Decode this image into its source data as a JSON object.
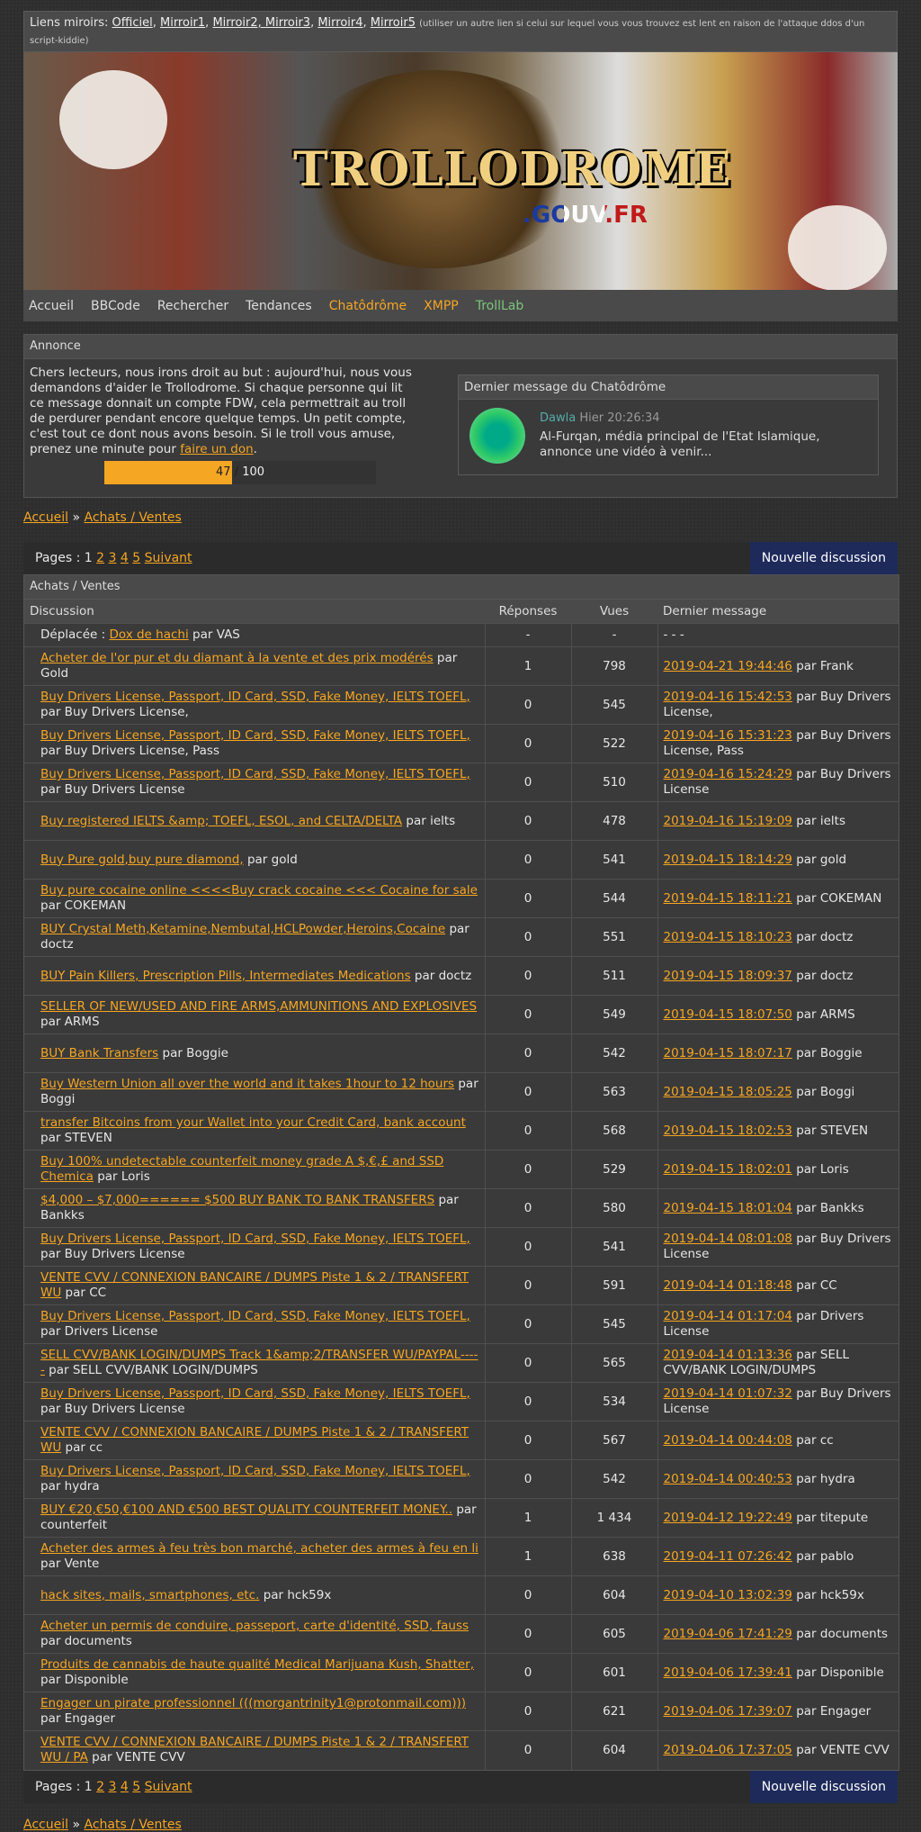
{
  "mirrors": {
    "prefix": "Liens miroirs:",
    "links": [
      "Officiel",
      "Mirroir1",
      "Mirroir2, Mirroir3",
      "Mirroir4",
      "Mirroir5"
    ],
    "note": "(utiliser un autre lien si celui sur lequel vous vous trouvez est lent en raison de l'attaque ddos d'un script-kiddie)"
  },
  "banner": {
    "logo": "TROLLODROME",
    "sub": ".GOUV.FR"
  },
  "nav": [
    "Accueil",
    "BBCode",
    "Rechercher",
    "Tendances",
    "Chatôdrôme",
    "XMPP",
    "TrollLab"
  ],
  "annonce": {
    "title": "Annonce",
    "text": "Chers lecteurs, nous irons droit au but : aujourd'hui, nous vous demandons d'aider le Trollodrome. Si chaque personne qui lit ce message donnait un compte FDW, cela permettrait au troll de perdurer pendant encore quelque temps. Un petit compte, c'est tout ce dont nous avons besoin. Si le troll vous amuse, prenez une minute pour",
    "link": "faire un don",
    "end": ".",
    "progress": {
      "value": 47,
      "max": 100,
      "label_value": "47",
      "label_sep": " / ",
      "label_max": "100"
    }
  },
  "chat": {
    "title": "Dernier message du Chatôdrôme",
    "user": "Dawla",
    "time": "Hier 20:26:34",
    "message": "Al-Furqan, média principal de l'Etat Islamique, annonce une vidéo à venir..."
  },
  "crumb": {
    "home": "Accueil",
    "sep": "»",
    "section": "Achats / Ventes"
  },
  "pager": {
    "label": "Pages : 1",
    "pages": [
      "2",
      "3",
      "4",
      "5"
    ],
    "next": "Suivant",
    "new": "Nouvelle discussion"
  },
  "forum": {
    "title": "Achats / Ventes",
    "cols": [
      "Discussion",
      "Réponses",
      "Vues",
      "Dernier message"
    ],
    "moved": {
      "prefix": "Déplacée :",
      "title": "Dox de hachi",
      "by": "par VAS",
      "rep": "-",
      "views": "-",
      "last": "- - -"
    },
    "rows": [
      {
        "title": "Acheter de l'or pur et du diamant à la vente et des prix modérés",
        "by": "par Gold",
        "rep": "1",
        "views": "798",
        "date": "2019-04-21 19:44:46",
        "last": "par Frank"
      },
      {
        "title": "Buy Drivers License, Passport, ID Card, SSD, Fake Money, IELTS TOEFL,",
        "by": "par Buy Drivers License,",
        "rep": "0",
        "views": "545",
        "date": "2019-04-16 15:42:53",
        "last": "par Buy Drivers License,"
      },
      {
        "title": "Buy Drivers License, Passport, ID Card, SSD, Fake Money, IELTS TOEFL,",
        "by": "par Buy Drivers License, Pass",
        "rep": "0",
        "views": "522",
        "date": "2019-04-16 15:31:23",
        "last": "par Buy Drivers License, Pass"
      },
      {
        "title": "Buy Drivers License, Passport, ID Card, SSD, Fake Money, IELTS TOEFL,",
        "by": "par Buy Drivers License",
        "rep": "0",
        "views": "510",
        "date": "2019-04-16 15:24:29",
        "last": "par Buy Drivers License"
      },
      {
        "title": "Buy registered IELTS &amp; TOEFL, ESOL, and CELTA/DELTA",
        "by": "par ielts",
        "rep": "0",
        "views": "478",
        "date": "2019-04-16 15:19:09",
        "last": "par ielts"
      },
      {
        "title": "Buy Pure gold,buy pure diamond,",
        "by": "par gold",
        "rep": "0",
        "views": "541",
        "date": "2019-04-15 18:14:29",
        "last": "par gold"
      },
      {
        "title": "Buy pure cocaine online <<<<Buy crack cocaine <<< Cocaine for sale",
        "by": "par COKEMAN",
        "rep": "0",
        "views": "544",
        "date": "2019-04-15 18:11:21",
        "last": "par COKEMAN"
      },
      {
        "title": "BUY Crystal Meth,Ketamine,Nembutal,HCLPowder,Heroins,Cocaine",
        "by": "par doctz",
        "rep": "0",
        "views": "551",
        "date": "2019-04-15 18:10:23",
        "last": "par doctz"
      },
      {
        "title": "BUY Pain Killers, Prescription Pills, Intermediates Medications",
        "by": "par doctz",
        "rep": "0",
        "views": "511",
        "date": "2019-04-15 18:09:37",
        "last": "par doctz"
      },
      {
        "title": "SELLER OF NEW/USED AND FIRE ARMS,AMMUNITIONS AND EXPLOSIVES",
        "by": "par ARMS",
        "rep": "0",
        "views": "549",
        "date": "2019-04-15 18:07:50",
        "last": "par ARMS"
      },
      {
        "title": "BUY Bank Transfers",
        "by": "par Boggie",
        "rep": "0",
        "views": "542",
        "date": "2019-04-15 18:07:17",
        "last": "par Boggie"
      },
      {
        "title": "Buy Western Union all over the world and it takes 1hour to 12 hours",
        "by": "par Boggi",
        "rep": "0",
        "views": "563",
        "date": "2019-04-15 18:05:25",
        "last": "par Boggi"
      },
      {
        "title": "transfer Bitcoins from your Wallet into your Credit Card, bank account",
        "by": "par STEVEN",
        "rep": "0",
        "views": "568",
        "date": "2019-04-15 18:02:53",
        "last": "par STEVEN"
      },
      {
        "title": "Buy 100% undetectable counterfeit money grade A $,€,£ and SSD Chemica",
        "by": "par Loris",
        "rep": "0",
        "views": "529",
        "date": "2019-04-15 18:02:01",
        "last": "par Loris"
      },
      {
        "title": "$4,000 – $7,000====== $500 BUY BANK TO BANK TRANSFERS",
        "by": "par Bankks",
        "rep": "0",
        "views": "580",
        "date": "2019-04-15 18:01:04",
        "last": "par Bankks"
      },
      {
        "title": "Buy Drivers License, Passport, ID Card, SSD, Fake Money, IELTS TOEFL,",
        "by": "par Buy Drivers License",
        "rep": "0",
        "views": "541",
        "date": "2019-04-14 08:01:08",
        "last": "par Buy Drivers License"
      },
      {
        "title": "VENTE CVV / CONNEXION BANCAIRE / DUMPS Piste 1 & 2 / TRANSFERT WU",
        "by": "par CC",
        "rep": "0",
        "views": "591",
        "date": "2019-04-14 01:18:48",
        "last": "par CC"
      },
      {
        "title": "Buy Drivers License, Passport, ID Card, SSD, Fake Money, IELTS TOEFL,",
        "by": "par Drivers License",
        "rep": "0",
        "views": "545",
        "date": "2019-04-14 01:17:04",
        "last": "par Drivers License"
      },
      {
        "title": "SELL CVV/BANK LOGIN/DUMPS Track 1&amp;2/TRANSFER WU/PAYPAL-----",
        "by": "par SELL CVV/BANK LOGIN/DUMPS",
        "rep": "0",
        "views": "565",
        "date": "2019-04-14 01:13:36",
        "last": "par SELL CVV/BANK LOGIN/DUMPS"
      },
      {
        "title": "Buy Drivers License, Passport, ID Card, SSD, Fake Money, IELTS TOEFL,",
        "by": "par Buy Drivers License",
        "rep": "0",
        "views": "534",
        "date": "2019-04-14 01:07:32",
        "last": "par Buy Drivers License"
      },
      {
        "title": "VENTE CVV / CONNEXION BANCAIRE / DUMPS Piste 1 & 2 / TRANSFERT WU",
        "by": "par cc",
        "rep": "0",
        "views": "567",
        "date": "2019-04-14 00:44:08",
        "last": "par cc"
      },
      {
        "title": "Buy Drivers License, Passport, ID Card, SSD, Fake Money, IELTS TOEFL,",
        "by": "par hydra",
        "rep": "0",
        "views": "542",
        "date": "2019-04-14 00:40:53",
        "last": "par hydra"
      },
      {
        "title": "BUY €20,€50,€100 AND €500 BEST QUALITY COUNTERFEIT MONEY..",
        "by": "par counterfeit",
        "rep": "1",
        "views": "1 434",
        "date": "2019-04-12 19:22:49",
        "last": "par titepute"
      },
      {
        "title": "Acheter des armes à feu très bon marché, acheter des armes à feu en li",
        "by": "par Vente",
        "rep": "1",
        "views": "638",
        "date": "2019-04-11 07:26:42",
        "last": "par pablo"
      },
      {
        "title": "hack sites, mails, smartphones, etc.",
        "by": "par hck59x",
        "rep": "0",
        "views": "604",
        "date": "2019-04-10 13:02:39",
        "last": "par hck59x"
      },
      {
        "title": "Acheter un permis de conduire, passeport, carte d'identité, SSD, fauss",
        "by": "par documents",
        "rep": "0",
        "views": "605",
        "date": "2019-04-06 17:41:29",
        "last": "par documents"
      },
      {
        "title": "Produits de cannabis de haute qualité Medical Marijuana Kush, Shatter,",
        "by": "par Disponible",
        "rep": "0",
        "views": "601",
        "date": "2019-04-06 17:39:41",
        "last": "par Disponible"
      },
      {
        "title": "Engager un pirate professionnel (((morgantrinity1@protonmail.com)))",
        "by": "par Engager",
        "rep": "0",
        "views": "621",
        "date": "2019-04-06 17:39:07",
        "last": "par Engager"
      },
      {
        "title": "VENTE CVV / CONNEXION BANCAIRE / DUMPS Piste 1 & 2 / TRANSFERT WU / PA",
        "by": "par VENTE CVV",
        "rep": "0",
        "views": "604",
        "date": "2019-04-06 17:37:05",
        "last": "par VENTE CVV"
      }
    ]
  },
  "colors": {
    "accent": "#f5a623",
    "button": "#1e2a5a",
    "bg": "#2e2e2e"
  }
}
